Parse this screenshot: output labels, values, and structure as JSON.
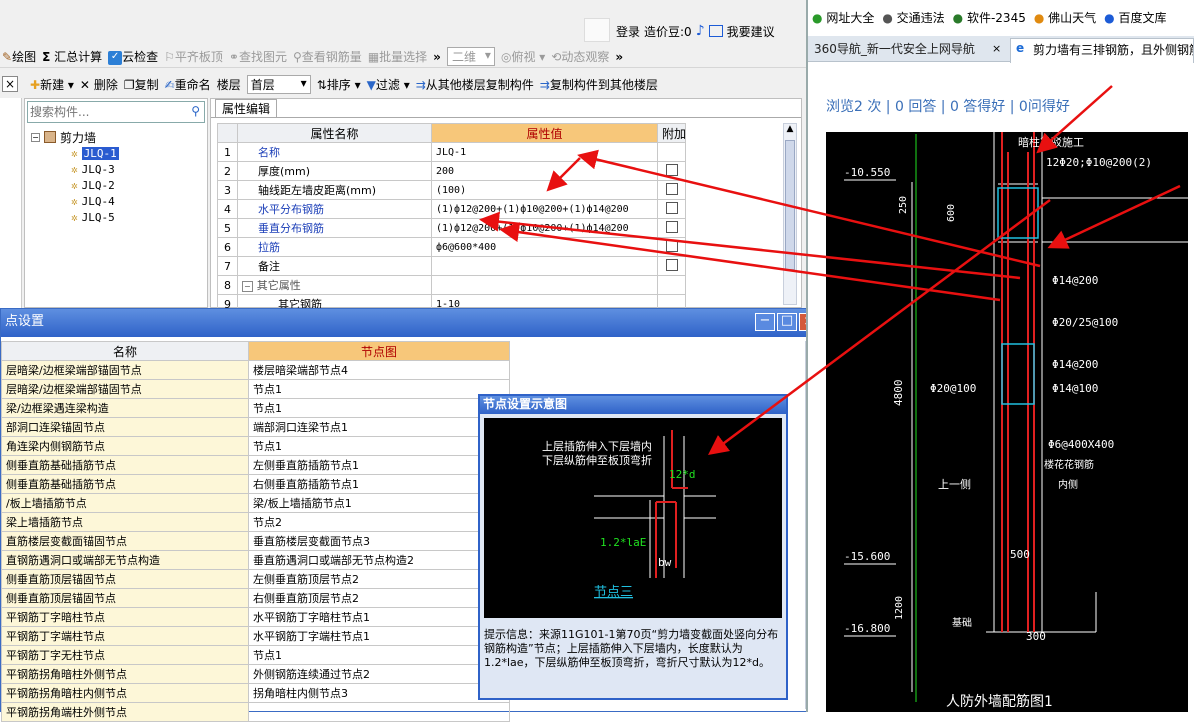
{
  "app": {
    "login": "登录",
    "price_label": "造价豆:0",
    "suggest": "我要建议"
  },
  "toolbar1": {
    "draw": "绘图",
    "sum": "汇总计算",
    "cloud": "云检查",
    "flat": "平齐板顶",
    "find": "查找图元",
    "view_rebar": "查看钢筋量",
    "batch": "批量选择",
    "dim": "二维",
    "view": "俯视",
    "dynamic": "动态观察"
  },
  "toolbar2": {
    "new": "新建",
    "delete": "删除",
    "copy": "复制",
    "rename": "重命名",
    "floor_label": "楼层",
    "floor_value": "首层",
    "sort": "排序",
    "filter": "过滤",
    "copy_from": "从其他楼层复制构件",
    "copy_to": "复制构件到其他楼层"
  },
  "tree": {
    "search_placeholder": "搜索构件...",
    "root": "剪力墙",
    "items": [
      "JLQ-1",
      "JLQ-3",
      "JLQ-2",
      "JLQ-4",
      "JLQ-5"
    ]
  },
  "prop": {
    "tab": "属性编辑",
    "headers": [
      "属性名称",
      "属性值",
      "附加"
    ],
    "rows": [
      {
        "n": "1",
        "name": "名称",
        "value": "JLQ-1",
        "blue": true,
        "chk": false
      },
      {
        "n": "2",
        "name": "厚度(mm)",
        "value": "200",
        "blue": false,
        "chk": true
      },
      {
        "n": "3",
        "name": "轴线距左墙皮距离(mm)",
        "value": "(100)",
        "blue": false,
        "chk": true
      },
      {
        "n": "4",
        "name": "水平分布钢筋",
        "value": "(1)ф12@200+(1)ф10@200+(1)ф14@200",
        "blue": true,
        "chk": true
      },
      {
        "n": "5",
        "name": "垂直分布钢筋",
        "value": "(1)ф12@200+(1)ф10@200+(1)ф14@200",
        "blue": true,
        "chk": true
      },
      {
        "n": "6",
        "name": "拉筋",
        "value": "ф6@600*400",
        "blue": true,
        "chk": true
      },
      {
        "n": "7",
        "name": "备注",
        "value": "",
        "blue": false,
        "chk": true
      },
      {
        "n": "8",
        "name": "其它属性",
        "value": "",
        "blue": false,
        "chk": false
      },
      {
        "n": "9",
        "name": "其它钢筋",
        "value": "1-10",
        "blue": false,
        "chk": false
      }
    ]
  },
  "node_dialog": {
    "title": "点设置",
    "headers": [
      "名称",
      "节点图"
    ],
    "rows": [
      [
        "层暗梁/边框梁端部锚固节点",
        "楼层暗梁端部节点4"
      ],
      [
        "层暗梁/边框梁端部锚固节点",
        "节点1"
      ],
      [
        "梁/边框梁遇连梁构造",
        "节点1"
      ],
      [
        "部洞口连梁锚固节点",
        "端部洞口连梁节点1"
      ],
      [
        "角连梁内侧钢筋节点",
        "节点1"
      ],
      [
        "侧垂直筋基础插筋节点",
        "左侧垂直筋插筋节点1"
      ],
      [
        "侧垂直筋基础插筋节点",
        "右侧垂直筋插筋节点1"
      ],
      [
        "/板上墙插筋节点",
        "梁/板上墙插筋节点1"
      ],
      [
        "梁上墙插筋节点",
        "节点2"
      ],
      [
        "直筋楼层变截面锚固节点",
        "垂直筋楼层变截面节点3"
      ],
      [
        "直钢筋遇洞口或端部无节点构造",
        "垂直筋遇洞口或端部无节点构造2"
      ],
      [
        "侧垂直筋顶层锚固节点",
        "左侧垂直筋顶层节点2"
      ],
      [
        "侧垂直筋顶层锚固节点",
        "右侧垂直筋顶层节点2"
      ],
      [
        "平钢筋丁字暗柱节点",
        "水平钢筋丁字暗柱节点1"
      ],
      [
        "平钢筋丁字端柱节点",
        "水平钢筋丁字端柱节点1"
      ],
      [
        "平钢筋丁字无柱节点",
        "节点1"
      ],
      [
        "平钢筋拐角暗柱外侧节点",
        "外侧钢筋连续通过节点2"
      ],
      [
        "平钢筋拐角暗柱内侧节点",
        "拐角暗柱内侧节点3"
      ],
      [
        "平钢筋拐角端柱外侧节点",
        ""
      ]
    ]
  },
  "schematic": {
    "title": "节点设置示意图",
    "note_line1": "上层插筋伸入下层墙内",
    "note_line2": "下层纵筋伸至板顶弯折",
    "dim1": "12*d",
    "dim2": "1.2*laE",
    "dim3": "bw",
    "node": "节点三",
    "hint_label": "提示信息：",
    "hint_text": "来源11G101-1第70页“剪力墙变截面处竖向分布钢筋构造”节点；上层插筋伸入下层墙内，长度默认为1.2*lae，下层纵筋伸至板顶弯折，弯折尺寸默认为12*d。"
  },
  "browser": {
    "bookmarks": [
      "网址大全",
      "交通违法",
      "软件-2345",
      "佛山天气",
      "百度文库"
    ],
    "tabs": [
      "360导航_新一代安全上网导航",
      "剪力墙有三排钢筋，且外侧钢筋"
    ],
    "stats": "浏览2 次 | 0 回答 | 0 答得好 | 0问得好"
  },
  "cad": {
    "top_label": "暗柱梁驳施工",
    "top_rebar": "12Φ20;Φ10@200(2)",
    "r1": "Φ14@200",
    "r2": "Φ20/25@100",
    "r3": "Φ14@200",
    "r4": "Φ14@100",
    "r5": "Φ20@100",
    "r6": "Φ6@400X400",
    "inner1": "楼花花钢筋",
    "inner2": "内侧",
    "upper": "上一侧",
    "elev1": "-10.550",
    "elev2": "-15.600",
    "elev3": "-16.800",
    "d250": "250",
    "d600": "600",
    "d4800": "4800",
    "d1200": "1200",
    "d500": "500",
    "d300": "300",
    "base": "基础",
    "caption": "人防外墙配筋图1"
  }
}
